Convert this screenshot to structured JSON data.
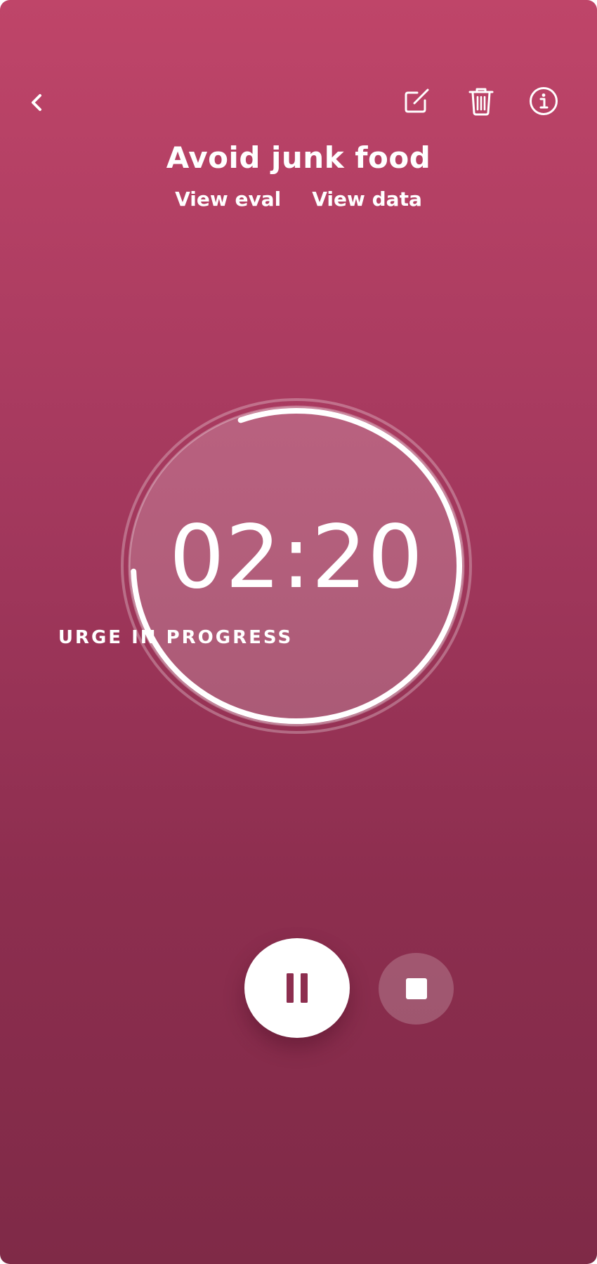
{
  "header": {
    "back_icon": "chevron-left-icon",
    "actions": [
      {
        "name": "edit",
        "icon": "edit-icon"
      },
      {
        "name": "delete",
        "icon": "trash-icon"
      },
      {
        "name": "info",
        "icon": "info-icon"
      }
    ]
  },
  "title": "Avoid junk food",
  "links": {
    "view_eval": "View eval",
    "view_data": "View data"
  },
  "timer": {
    "time": "02:20",
    "status": "URGE IN PROGRESS",
    "progress_fraction": 0.8
  },
  "controls": {
    "pause_icon": "pause-icon",
    "stop_icon": "stop-icon"
  },
  "colors": {
    "gradient_top": "#bf4569",
    "gradient_bottom": "#7f2a47",
    "pause_glyph": "#8d2e4f",
    "foreground": "#ffffff"
  }
}
